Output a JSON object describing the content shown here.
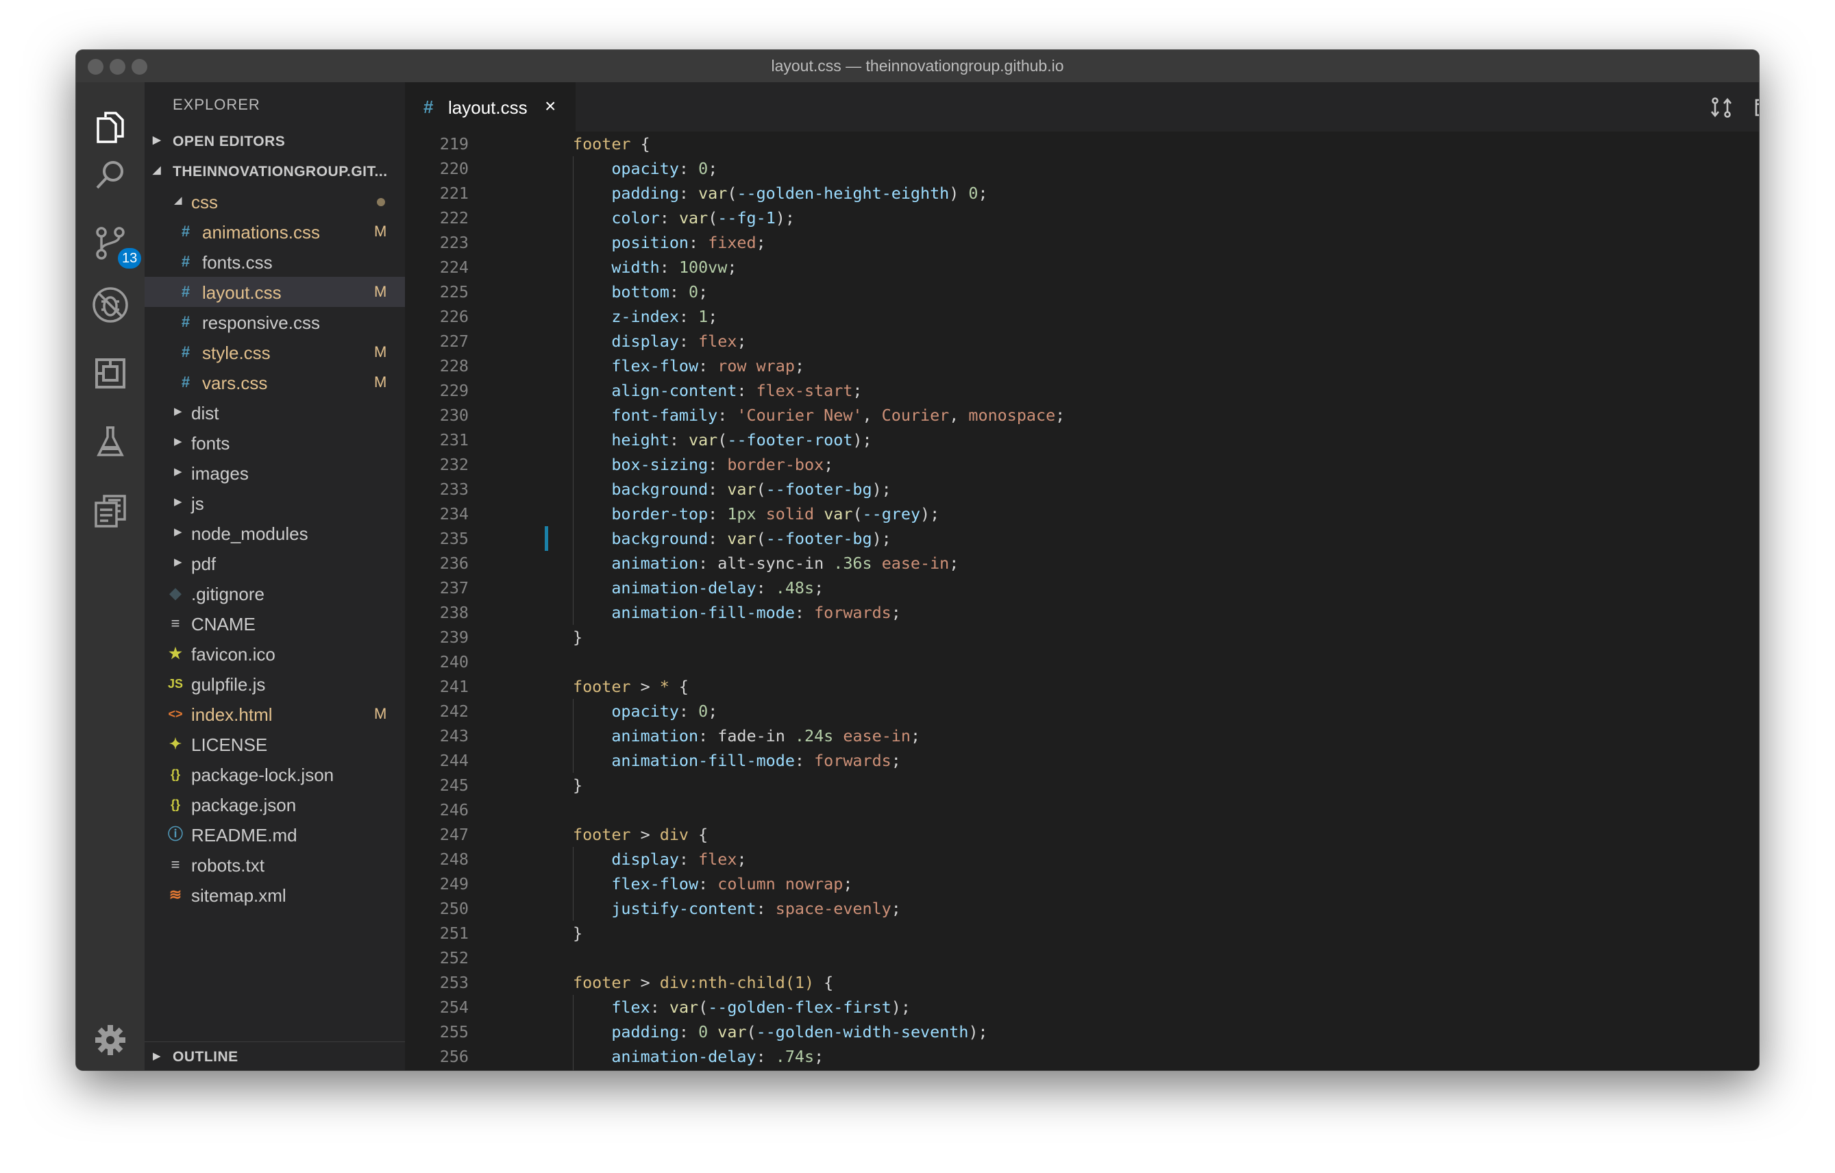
{
  "window": {
    "title": "layout.css — theinnovationgroup.github.io"
  },
  "activity_bar": {
    "icons": [
      "files-icon",
      "search-icon",
      "source-control-icon",
      "debug-icon",
      "extensions-icon",
      "flask-icon",
      "clipboard-icon",
      "gear-icon"
    ],
    "scm_badge": "13"
  },
  "sidebar": {
    "header": "EXPLORER",
    "open_editors": "OPEN EDITORS",
    "project": "THEINNOVATIONGROUP.GIT...",
    "outline": "OUTLINE",
    "tree": [
      {
        "name": "css",
        "type": "folder-open",
        "status": "dot"
      },
      {
        "name": "animations.css",
        "type": "css",
        "status": "M"
      },
      {
        "name": "fonts.css",
        "type": "css",
        "status": ""
      },
      {
        "name": "layout.css",
        "type": "css",
        "status": "M",
        "active": true
      },
      {
        "name": "responsive.css",
        "type": "css",
        "status": ""
      },
      {
        "name": "style.css",
        "type": "css",
        "status": "M"
      },
      {
        "name": "vars.css",
        "type": "css",
        "status": "M"
      },
      {
        "name": "dist",
        "type": "folder",
        "status": ""
      },
      {
        "name": "fonts",
        "type": "folder",
        "status": ""
      },
      {
        "name": "images",
        "type": "folder",
        "status": ""
      },
      {
        "name": "js",
        "type": "folder",
        "status": ""
      },
      {
        "name": "node_modules",
        "type": "folder",
        "status": ""
      },
      {
        "name": "pdf",
        "type": "folder",
        "status": ""
      },
      {
        "name": ".gitignore",
        "type": "git",
        "status": ""
      },
      {
        "name": "CNAME",
        "type": "text",
        "status": ""
      },
      {
        "name": "favicon.ico",
        "type": "star",
        "status": ""
      },
      {
        "name": "gulpfile.js",
        "type": "js",
        "status": ""
      },
      {
        "name": "index.html",
        "type": "html",
        "status": "M"
      },
      {
        "name": "LICENSE",
        "type": "license",
        "status": ""
      },
      {
        "name": "package-lock.json",
        "type": "json",
        "status": ""
      },
      {
        "name": "package.json",
        "type": "json",
        "status": ""
      },
      {
        "name": "README.md",
        "type": "info",
        "status": ""
      },
      {
        "name": "robots.txt",
        "type": "text",
        "status": ""
      },
      {
        "name": "sitemap.xml",
        "type": "rss",
        "status": ""
      }
    ]
  },
  "editor": {
    "tab": {
      "icon": "#",
      "name": "layout.css",
      "close": "×"
    },
    "actions": [
      "open-changes-icon",
      "split-editor-icon",
      "more-actions-icon"
    ],
    "lines": [
      {
        "n": "219",
        "t": [
          [
            "sel",
            "footer"
          ],
          [
            "pun",
            " {"
          ]
        ]
      },
      {
        "n": "220",
        "t": [
          [
            "sp",
            "    "
          ],
          [
            "prop",
            "opacity"
          ],
          [
            "pun",
            ": "
          ],
          [
            "num",
            "0"
          ],
          [
            "pun",
            ";"
          ]
        ]
      },
      {
        "n": "221",
        "t": [
          [
            "sp",
            "    "
          ],
          [
            "prop",
            "padding"
          ],
          [
            "pun",
            ": "
          ],
          [
            "fn",
            "var"
          ],
          [
            "pun",
            "("
          ],
          [
            "prop",
            "--golden-height-eighth"
          ],
          [
            "pun",
            ") "
          ],
          [
            "num",
            "0"
          ],
          [
            "pun",
            ";"
          ]
        ]
      },
      {
        "n": "222",
        "t": [
          [
            "sp",
            "    "
          ],
          [
            "prop",
            "color"
          ],
          [
            "pun",
            ": "
          ],
          [
            "fn",
            "var"
          ],
          [
            "pun",
            "("
          ],
          [
            "prop",
            "--fg-1"
          ],
          [
            "pun",
            ");"
          ]
        ]
      },
      {
        "n": "223",
        "t": [
          [
            "sp",
            "    "
          ],
          [
            "prop",
            "position"
          ],
          [
            "pun",
            ": "
          ],
          [
            "str",
            "fixed"
          ],
          [
            "pun",
            ";"
          ]
        ]
      },
      {
        "n": "224",
        "t": [
          [
            "sp",
            "    "
          ],
          [
            "prop",
            "width"
          ],
          [
            "pun",
            ": "
          ],
          [
            "num",
            "100vw"
          ],
          [
            "pun",
            ";"
          ]
        ]
      },
      {
        "n": "225",
        "t": [
          [
            "sp",
            "    "
          ],
          [
            "prop",
            "bottom"
          ],
          [
            "pun",
            ": "
          ],
          [
            "num",
            "0"
          ],
          [
            "pun",
            ";"
          ]
        ]
      },
      {
        "n": "226",
        "t": [
          [
            "sp",
            "    "
          ],
          [
            "prop",
            "z-index"
          ],
          [
            "pun",
            ": "
          ],
          [
            "num",
            "1"
          ],
          [
            "pun",
            ";"
          ]
        ]
      },
      {
        "n": "227",
        "t": [
          [
            "sp",
            "    "
          ],
          [
            "prop",
            "display"
          ],
          [
            "pun",
            ": "
          ],
          [
            "str",
            "flex"
          ],
          [
            "pun",
            ";"
          ]
        ]
      },
      {
        "n": "228",
        "t": [
          [
            "sp",
            "    "
          ],
          [
            "prop",
            "flex-flow"
          ],
          [
            "pun",
            ": "
          ],
          [
            "str",
            "row wrap"
          ],
          [
            "pun",
            ";"
          ]
        ]
      },
      {
        "n": "229",
        "t": [
          [
            "sp",
            "    "
          ],
          [
            "prop",
            "align-content"
          ],
          [
            "pun",
            ": "
          ],
          [
            "str",
            "flex-start"
          ],
          [
            "pun",
            ";"
          ]
        ]
      },
      {
        "n": "230",
        "t": [
          [
            "sp",
            "    "
          ],
          [
            "prop",
            "font-family"
          ],
          [
            "pun",
            ": "
          ],
          [
            "str",
            "'Courier New'"
          ],
          [
            "pun",
            ", "
          ],
          [
            "str",
            "Courier"
          ],
          [
            "pun",
            ", "
          ],
          [
            "str",
            "monospace"
          ],
          [
            "pun",
            ";"
          ]
        ]
      },
      {
        "n": "231",
        "t": [
          [
            "sp",
            "    "
          ],
          [
            "prop",
            "height"
          ],
          [
            "pun",
            ": "
          ],
          [
            "fn",
            "var"
          ],
          [
            "pun",
            "("
          ],
          [
            "prop",
            "--footer-root"
          ],
          [
            "pun",
            ");"
          ]
        ]
      },
      {
        "n": "232",
        "t": [
          [
            "sp",
            "    "
          ],
          [
            "prop",
            "box-sizing"
          ],
          [
            "pun",
            ": "
          ],
          [
            "str",
            "border-box"
          ],
          [
            "pun",
            ";"
          ]
        ]
      },
      {
        "n": "233",
        "t": [
          [
            "sp",
            "    "
          ],
          [
            "prop",
            "background"
          ],
          [
            "pun",
            ": "
          ],
          [
            "fn",
            "var"
          ],
          [
            "pun",
            "("
          ],
          [
            "prop",
            "--footer-bg"
          ],
          [
            "pun",
            ");"
          ]
        ]
      },
      {
        "n": "234",
        "t": [
          [
            "sp",
            "    "
          ],
          [
            "prop",
            "border-top"
          ],
          [
            "pun",
            ": "
          ],
          [
            "num",
            "1px"
          ],
          [
            "pun",
            " "
          ],
          [
            "str",
            "solid"
          ],
          [
            "pun",
            " "
          ],
          [
            "fn",
            "var"
          ],
          [
            "pun",
            "("
          ],
          [
            "prop",
            "--grey"
          ],
          [
            "pun",
            ");"
          ]
        ]
      },
      {
        "n": "235",
        "t": [
          [
            "sp",
            "    "
          ],
          [
            "prop",
            "background"
          ],
          [
            "pun",
            ": "
          ],
          [
            "fn",
            "var"
          ],
          [
            "pun",
            "("
          ],
          [
            "prop",
            "--footer-bg"
          ],
          [
            "pun",
            ");"
          ]
        ]
      },
      {
        "n": "236",
        "t": [
          [
            "sp",
            "    "
          ],
          [
            "prop",
            "animation"
          ],
          [
            "pun",
            ": alt-sync-in "
          ],
          [
            "num",
            ".36s"
          ],
          [
            "pun",
            " "
          ],
          [
            "str",
            "ease-in"
          ],
          [
            "pun",
            ";"
          ]
        ]
      },
      {
        "n": "237",
        "t": [
          [
            "sp",
            "    "
          ],
          [
            "prop",
            "animation-delay"
          ],
          [
            "pun",
            ": "
          ],
          [
            "num",
            ".48s"
          ],
          [
            "pun",
            ";"
          ]
        ]
      },
      {
        "n": "238",
        "t": [
          [
            "sp",
            "    "
          ],
          [
            "prop",
            "animation-fill-mode"
          ],
          [
            "pun",
            ": "
          ],
          [
            "str",
            "forwards"
          ],
          [
            "pun",
            ";"
          ]
        ]
      },
      {
        "n": "239",
        "t": [
          [
            "pun",
            "}"
          ]
        ]
      },
      {
        "n": "240",
        "t": []
      },
      {
        "n": "241",
        "t": [
          [
            "sel",
            "footer"
          ],
          [
            "pun",
            " > "
          ],
          [
            "sel",
            "*"
          ],
          [
            "pun",
            " {"
          ]
        ]
      },
      {
        "n": "242",
        "t": [
          [
            "sp",
            "    "
          ],
          [
            "prop",
            "opacity"
          ],
          [
            "pun",
            ": "
          ],
          [
            "num",
            "0"
          ],
          [
            "pun",
            ";"
          ]
        ]
      },
      {
        "n": "243",
        "t": [
          [
            "sp",
            "    "
          ],
          [
            "prop",
            "animation"
          ],
          [
            "pun",
            ": fade-in "
          ],
          [
            "num",
            ".24s"
          ],
          [
            "pun",
            " "
          ],
          [
            "str",
            "ease-in"
          ],
          [
            "pun",
            ";"
          ]
        ]
      },
      {
        "n": "244",
        "t": [
          [
            "sp",
            "    "
          ],
          [
            "prop",
            "animation-fill-mode"
          ],
          [
            "pun",
            ": "
          ],
          [
            "str",
            "forwards"
          ],
          [
            "pun",
            ";"
          ]
        ]
      },
      {
        "n": "245",
        "t": [
          [
            "pun",
            "}"
          ]
        ]
      },
      {
        "n": "246",
        "t": []
      },
      {
        "n": "247",
        "t": [
          [
            "sel",
            "footer"
          ],
          [
            "pun",
            " > "
          ],
          [
            "sel",
            "div"
          ],
          [
            "pun",
            " {"
          ]
        ]
      },
      {
        "n": "248",
        "t": [
          [
            "sp",
            "    "
          ],
          [
            "prop",
            "display"
          ],
          [
            "pun",
            ": "
          ],
          [
            "str",
            "flex"
          ],
          [
            "pun",
            ";"
          ]
        ]
      },
      {
        "n": "249",
        "t": [
          [
            "sp",
            "    "
          ],
          [
            "prop",
            "flex-flow"
          ],
          [
            "pun",
            ": "
          ],
          [
            "str",
            "column nowrap"
          ],
          [
            "pun",
            ";"
          ]
        ]
      },
      {
        "n": "250",
        "t": [
          [
            "sp",
            "    "
          ],
          [
            "prop",
            "justify-content"
          ],
          [
            "pun",
            ": "
          ],
          [
            "str",
            "space-evenly"
          ],
          [
            "pun",
            ";"
          ]
        ]
      },
      {
        "n": "251",
        "t": [
          [
            "pun",
            "}"
          ]
        ]
      },
      {
        "n": "252",
        "t": []
      },
      {
        "n": "253",
        "t": [
          [
            "sel",
            "footer"
          ],
          [
            "pun",
            " > "
          ],
          [
            "sel",
            "div:nth-child(1)"
          ],
          [
            "pun",
            " {"
          ]
        ]
      },
      {
        "n": "254",
        "t": [
          [
            "sp",
            "    "
          ],
          [
            "prop",
            "flex"
          ],
          [
            "pun",
            ": "
          ],
          [
            "fn",
            "var"
          ],
          [
            "pun",
            "("
          ],
          [
            "prop",
            "--golden-flex-first"
          ],
          [
            "pun",
            ");"
          ]
        ]
      },
      {
        "n": "255",
        "t": [
          [
            "sp",
            "    "
          ],
          [
            "prop",
            "padding"
          ],
          [
            "pun",
            ": "
          ],
          [
            "num",
            "0"
          ],
          [
            "pun",
            " "
          ],
          [
            "fn",
            "var"
          ],
          [
            "pun",
            "("
          ],
          [
            "prop",
            "--golden-width-seventh"
          ],
          [
            "pun",
            ");"
          ]
        ]
      },
      {
        "n": "256",
        "t": [
          [
            "sp",
            "    "
          ],
          [
            "prop",
            "animation-delay"
          ],
          [
            "pun",
            ": "
          ],
          [
            "num",
            ".74s"
          ],
          [
            "pun",
            ";"
          ]
        ]
      }
    ]
  },
  "colors": {
    "accent": "#007acc",
    "modified": "#e2c08d",
    "selector": "#d7ba7d",
    "property": "#9cdcfe",
    "number": "#b5cea8",
    "string": "#ce9178"
  }
}
